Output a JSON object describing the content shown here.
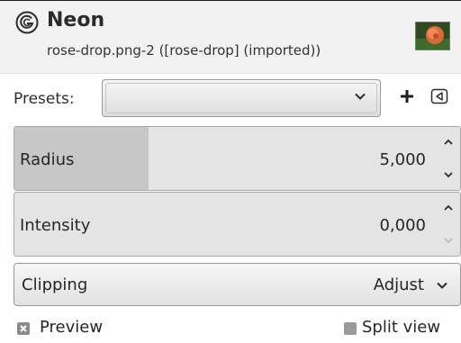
{
  "header": {
    "title": "Neon",
    "subtitle": "rose-drop.png-2 ([rose-drop] (imported))",
    "filter_icon": "gegl-filter-icon",
    "thumbnail": "rose-thumbnail"
  },
  "presets": {
    "label": "Presets:",
    "value": "",
    "add_icon": "plus-icon",
    "menu_icon": "collapse-menu-icon"
  },
  "radius": {
    "label": "Radius",
    "value": "5,000",
    "fill_fraction": 0.3
  },
  "intensity": {
    "label": "Intensity",
    "value": "0,000",
    "fill_fraction": 0.0
  },
  "clipping": {
    "label": "Clipping",
    "value": "Adjust"
  },
  "preview": {
    "label": "Preview",
    "checked": true
  },
  "split_view": {
    "label": "Split view",
    "checked": false
  },
  "colors": {
    "header_bg": "#f2f2f2",
    "scale_fill": "#c7c7c7",
    "scale_bg": "#e4e4e4"
  }
}
